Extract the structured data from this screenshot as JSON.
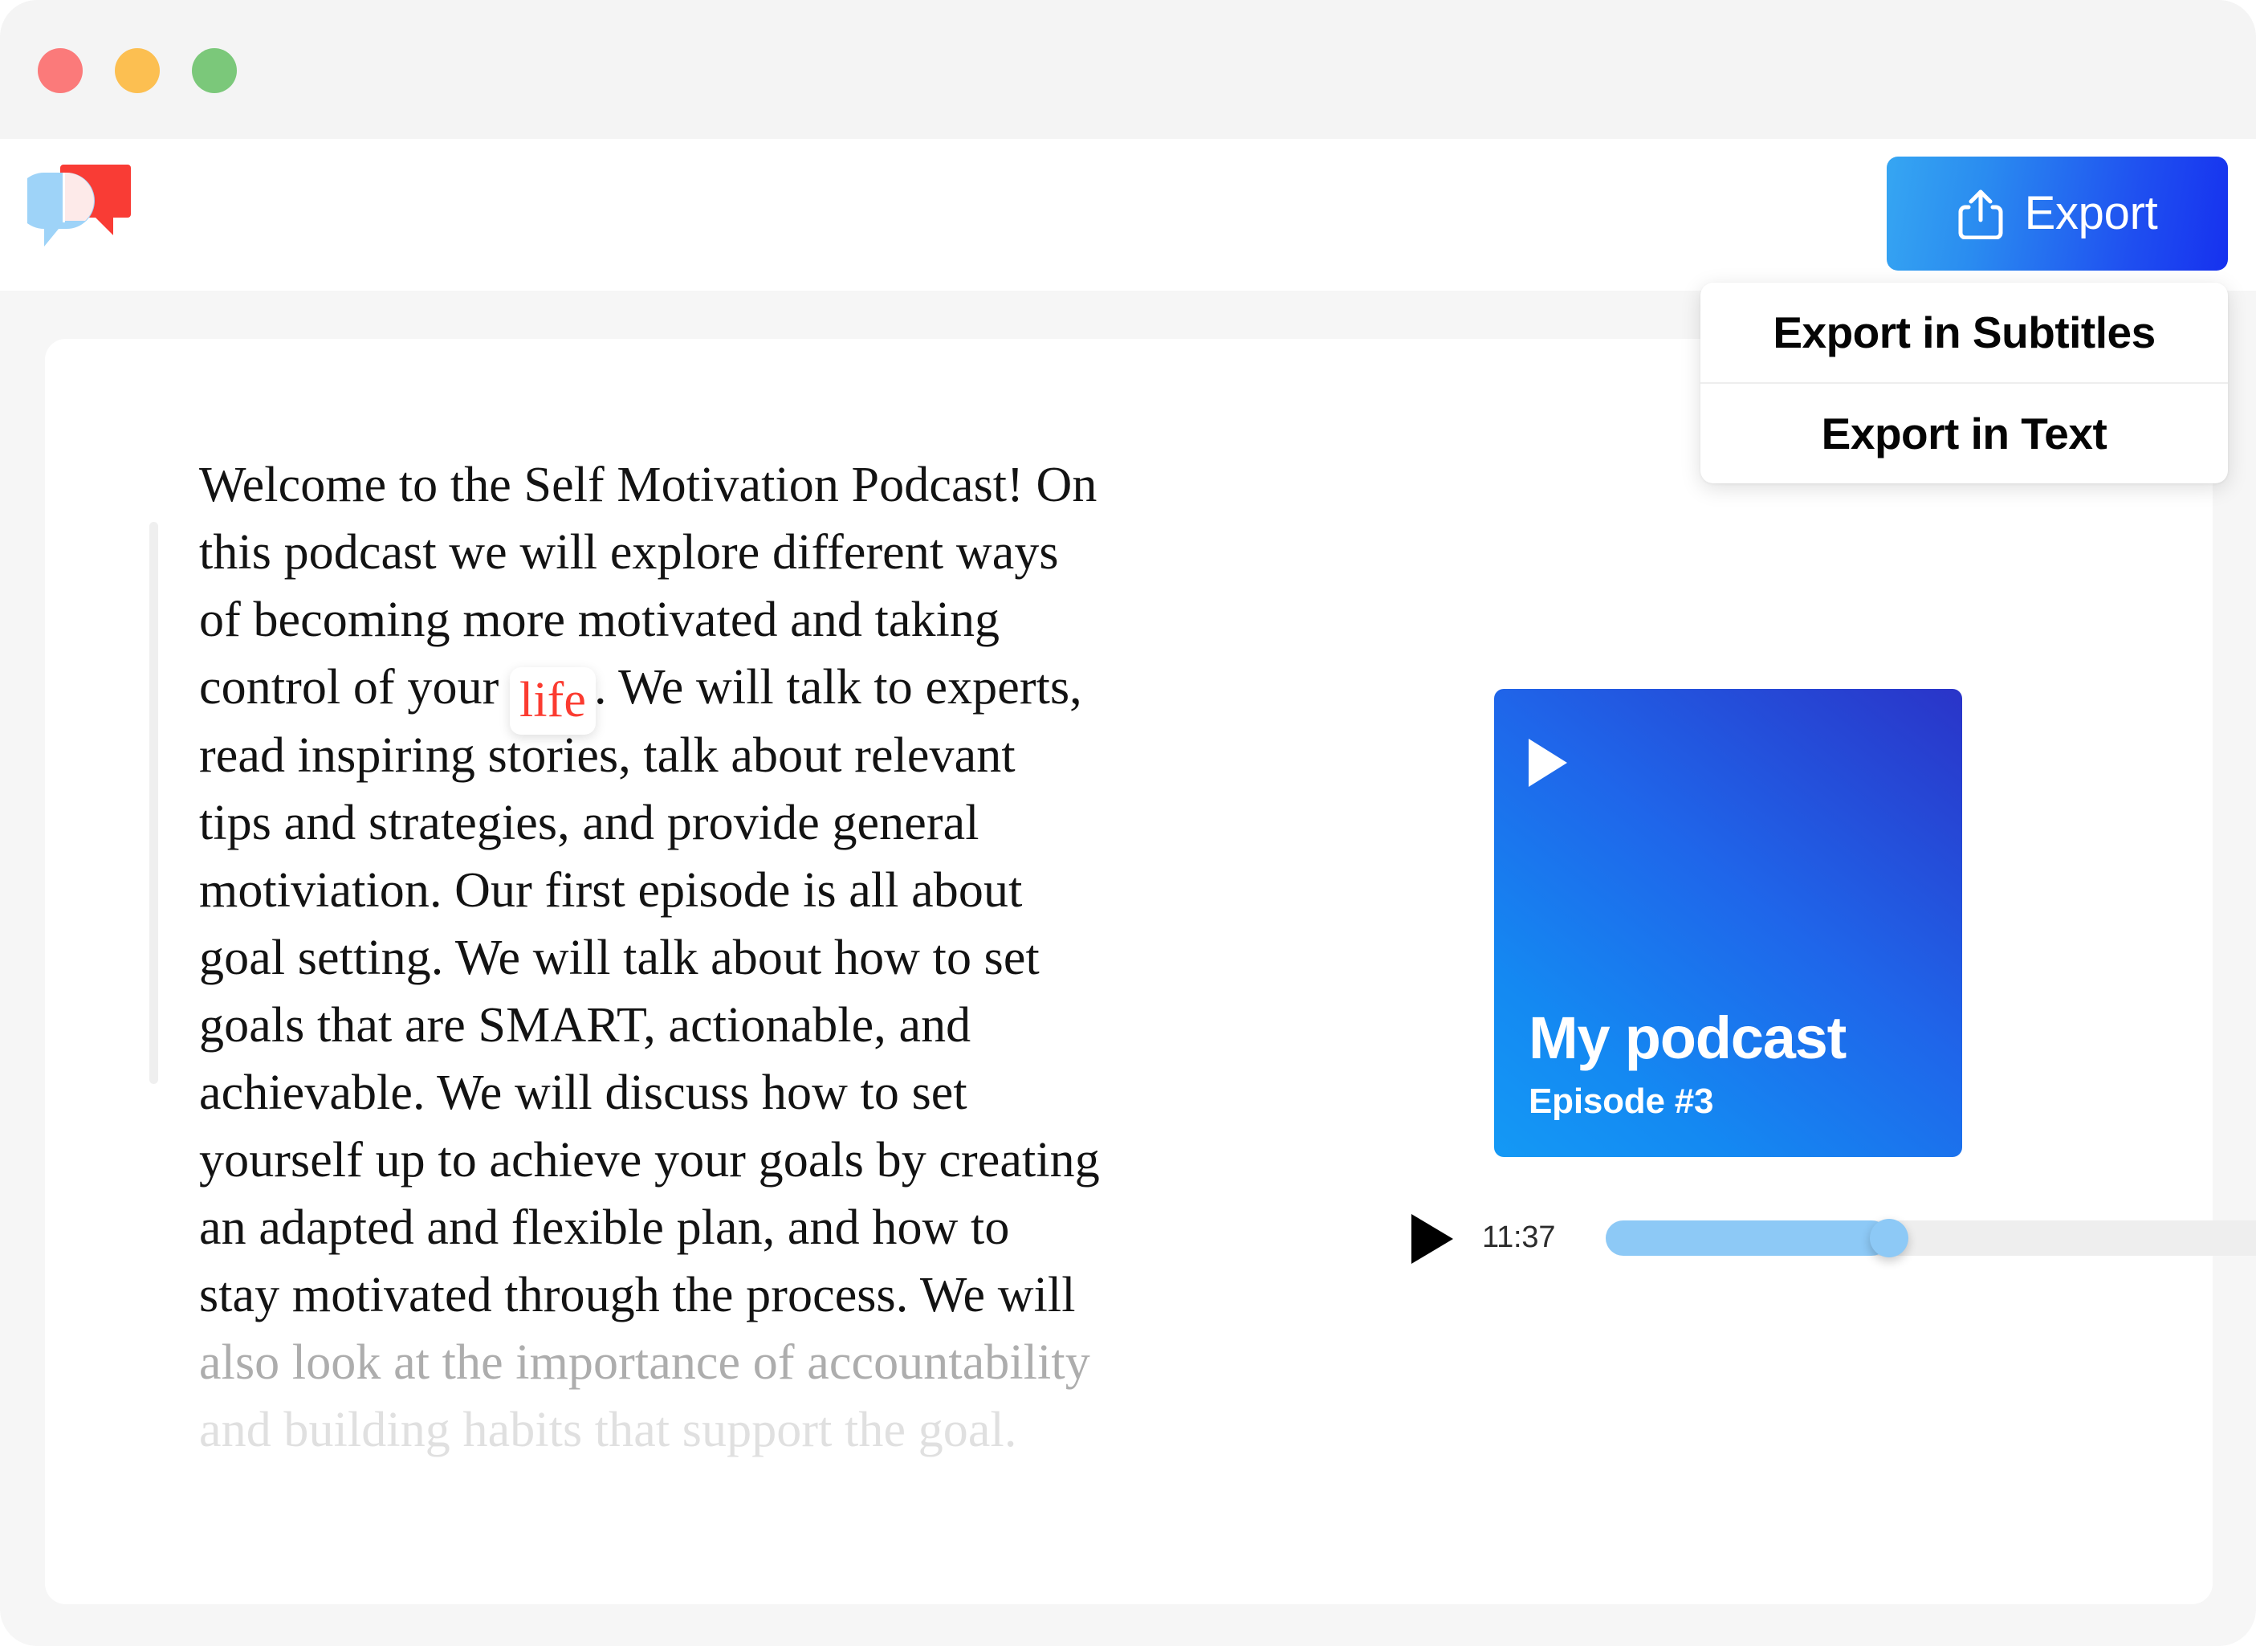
{
  "window": {
    "traffic_lights": [
      {
        "name": "close",
        "color": "#fb7a7a"
      },
      {
        "name": "minimize",
        "color": "#fcbf51"
      },
      {
        "name": "maximize",
        "color": "#7bc87a"
      }
    ]
  },
  "toolbar": {
    "logo_name": "speech-bubbles-logo",
    "export_label": "Export",
    "export_icon": "share-upload-icon",
    "export_gradient_from": "#36a6f2",
    "export_gradient_to": "#1631ef"
  },
  "export_menu": {
    "items": [
      {
        "label": "Export in Subtitles"
      },
      {
        "label": "Export in Text"
      }
    ]
  },
  "transcript": {
    "highlight_word": "life",
    "highlight_color": "#fb3b30",
    "lines": [
      {
        "text": "Welcome to the Self Motivation Podcast! On",
        "state": "normal"
      },
      {
        "text": "this podcast we will explore different ways",
        "state": "normal"
      },
      {
        "text": "of becoming more motivated and taking",
        "state": "normal"
      },
      {
        "text": "control of your ",
        "state": "highlight",
        "after": ". We will talk to experts,"
      },
      {
        "text": "read inspiring stories, talk about relevant",
        "state": "normal"
      },
      {
        "text": "tips and strategies, and provide general",
        "state": "normal"
      },
      {
        "text": "motiviation. Our first episode is all about",
        "state": "normal"
      },
      {
        "text": "goal setting. We will talk about how to set",
        "state": "normal"
      },
      {
        "text": "goals that are SMART, actionable, and",
        "state": "normal"
      },
      {
        "text": "achievable. We will discuss how to set",
        "state": "normal"
      },
      {
        "text": "yourself up to achieve your goals by creating",
        "state": "normal"
      },
      {
        "text": "an adapted and flexible plan, and how to",
        "state": "normal"
      },
      {
        "text": "stay motivated through the process. We will",
        "state": "normal"
      },
      {
        "text": "also look at the importance of accountability",
        "state": "faded"
      },
      {
        "text": "and building habits that support the goal.",
        "state": "more-faded"
      }
    ]
  },
  "player": {
    "cover": {
      "title": "My podcast",
      "episode": "Episode #3",
      "play_icon": "play-triangle-icon",
      "gradient_from": "#1499f5",
      "gradient_to": "#2a34c8"
    },
    "play_icon": "play-triangle-icon",
    "current_time": "11:37",
    "progress_percent": 42,
    "progress_fill_color": "#8dc9f6",
    "volume_icon": "speaker-volume-icon"
  }
}
